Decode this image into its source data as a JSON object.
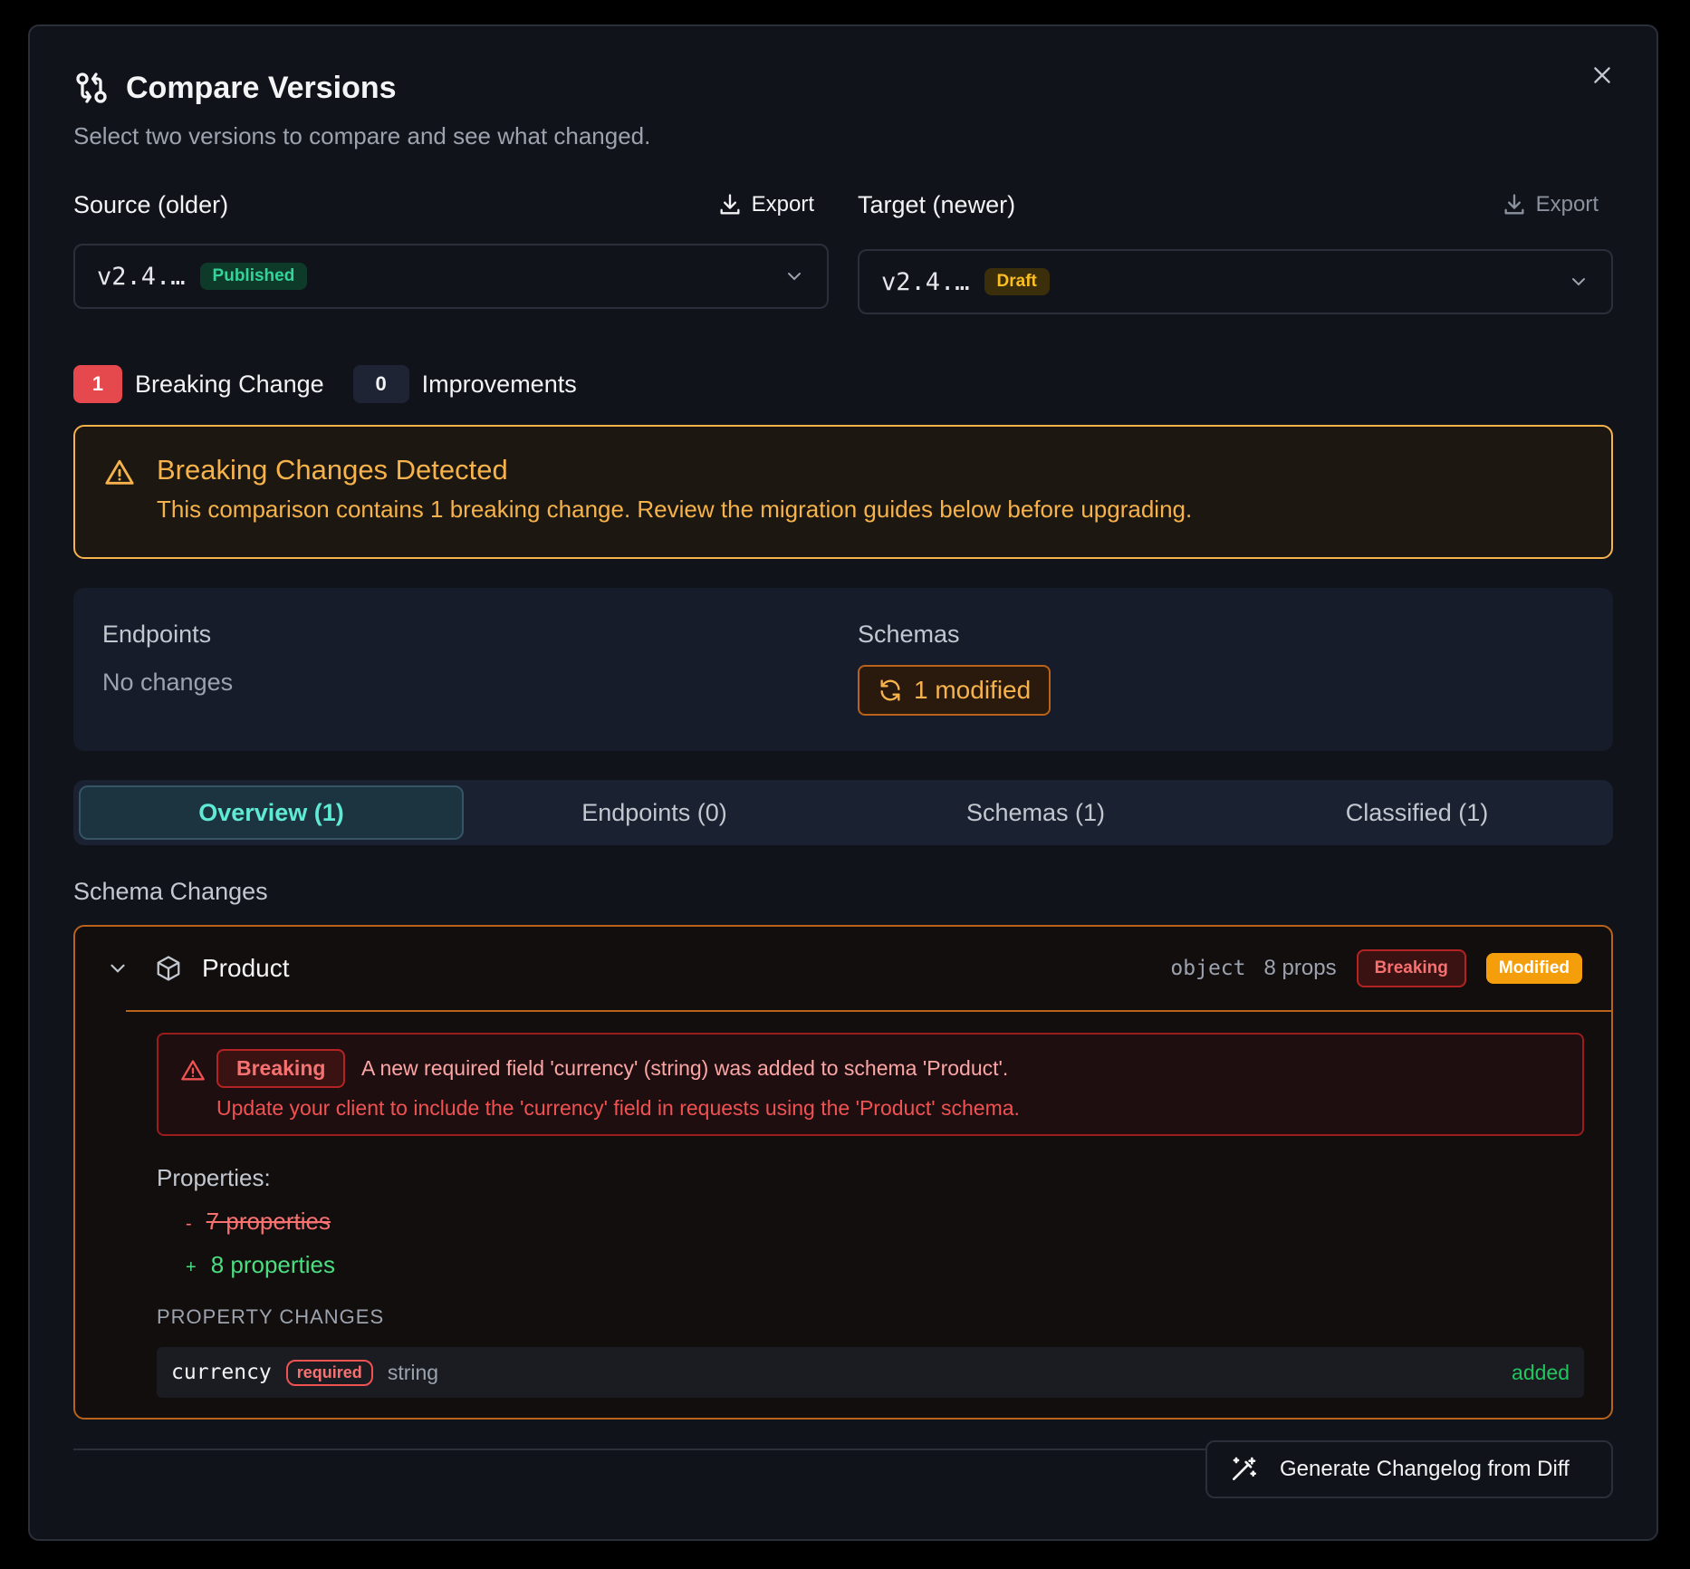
{
  "dialog": {
    "title": "Compare Versions",
    "subtitle": "Select two versions to compare and see what changed."
  },
  "source": {
    "label": "Source (older)",
    "export_label": "Export",
    "version": "v2.4.…",
    "status": "Published"
  },
  "target": {
    "label": "Target (newer)",
    "export_label": "Export",
    "version": "v2.4.…",
    "status": "Draft"
  },
  "counts": {
    "breaking_count": "1",
    "breaking_label": "Breaking Change",
    "improvements_count": "0",
    "improvements_label": "Improvements"
  },
  "alert": {
    "title": "Breaking Changes Detected",
    "message": "This comparison contains 1 breaking change. Review the migration guides below before upgrading."
  },
  "summary": {
    "endpoints_label": "Endpoints",
    "endpoints_value": "No changes",
    "schemas_label": "Schemas",
    "schemas_value": "1 modified"
  },
  "tabs": [
    {
      "label": "Overview (1)",
      "active": true
    },
    {
      "label": "Endpoints (0)",
      "active": false
    },
    {
      "label": "Schemas (1)",
      "active": false
    },
    {
      "label": "Classified (1)",
      "active": false
    }
  ],
  "schema_changes": {
    "section_label": "Schema Changes",
    "schema": {
      "name": "Product",
      "type": "object",
      "props": "8 props",
      "breaking_badge": "Breaking",
      "modified_badge": "Modified",
      "breaking_tag": "Breaking",
      "breaking_message": "A new required field 'currency' (string) was added to schema 'Product'.",
      "breaking_hint": "Update your client to include the 'currency' field in requests using the 'Product' schema.",
      "properties_label": "Properties:",
      "removed_sign": "-",
      "removed_value": "7 properties",
      "added_sign": "+",
      "added_value": "8 properties",
      "property_changes_label": "PROPERTY CHANGES",
      "property_change": {
        "name": "currency",
        "required": "required",
        "type": "string",
        "status": "added"
      }
    }
  },
  "footer": {
    "generate_label": "Generate Changelog from Diff"
  },
  "colors": {
    "accent_teal": "#5eead4",
    "warning": "#f6b24b",
    "danger": "#f87171",
    "success": "#22c55e"
  }
}
